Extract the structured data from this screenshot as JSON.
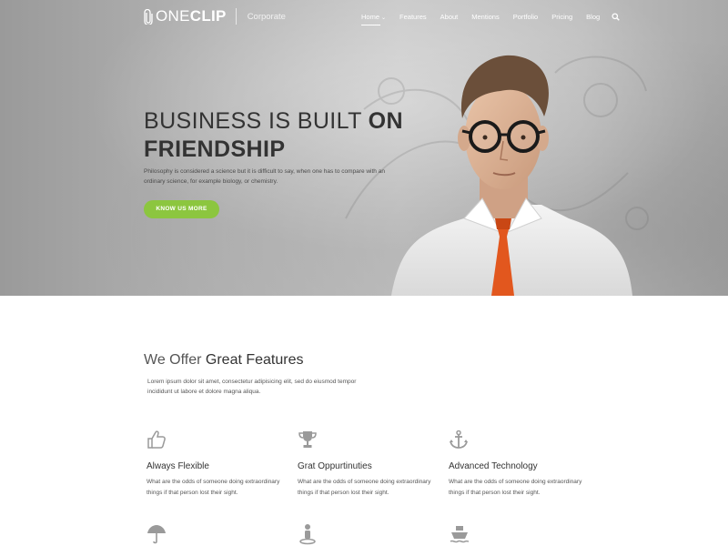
{
  "brand": {
    "logo_light": "ONE",
    "logo_bold": "CLIP",
    "subtitle": "Corporate"
  },
  "nav": {
    "items": [
      {
        "label": "Home"
      },
      {
        "label": "Features"
      },
      {
        "label": "About"
      },
      {
        "label": "Mentions"
      },
      {
        "label": "Portfolio"
      },
      {
        "label": "Pricing"
      },
      {
        "label": "Blog"
      }
    ],
    "active_index": 0
  },
  "hero": {
    "headline_light": "BUSINESS IS BUILT",
    "headline_strong_1": "ON",
    "headline_strong_2": "FRIENDSHIP",
    "subtext": "Philosophy is considered a science but it is difficult to say, when one has to compare with an ordinary science, for example biology, or chemistry.",
    "cta_label": "KNOW US MORE"
  },
  "features": {
    "title_light": "We Offer",
    "title_dark": "Great Features",
    "lead": "Lorem ipsum dolor sit amet, consectetur adipisicing elit, sed do eiusmod tempor incididunt ut labore et dolore magna aliqua.",
    "items": [
      {
        "icon": "thumbs-up-icon",
        "title": "Always Flexible",
        "desc": "What are the odds of someone doing extraordinary things if that person lost their sight."
      },
      {
        "icon": "trophy-icon",
        "title": "Grat Oppurtinuties",
        "desc": "What are the odds of someone doing extraordinary things if that person lost their sight."
      },
      {
        "icon": "anchor-icon",
        "title": "Advanced Technology",
        "desc": "What are the odds of someone doing extraordinary things if that person lost their sight."
      }
    ],
    "second_row_icons": [
      "umbrella-icon",
      "person-marker-icon",
      "ship-icon"
    ]
  },
  "colors": {
    "accent": "#8cc63f",
    "tie": "#e2571e",
    "icon_gray": "#9a9a9a"
  }
}
